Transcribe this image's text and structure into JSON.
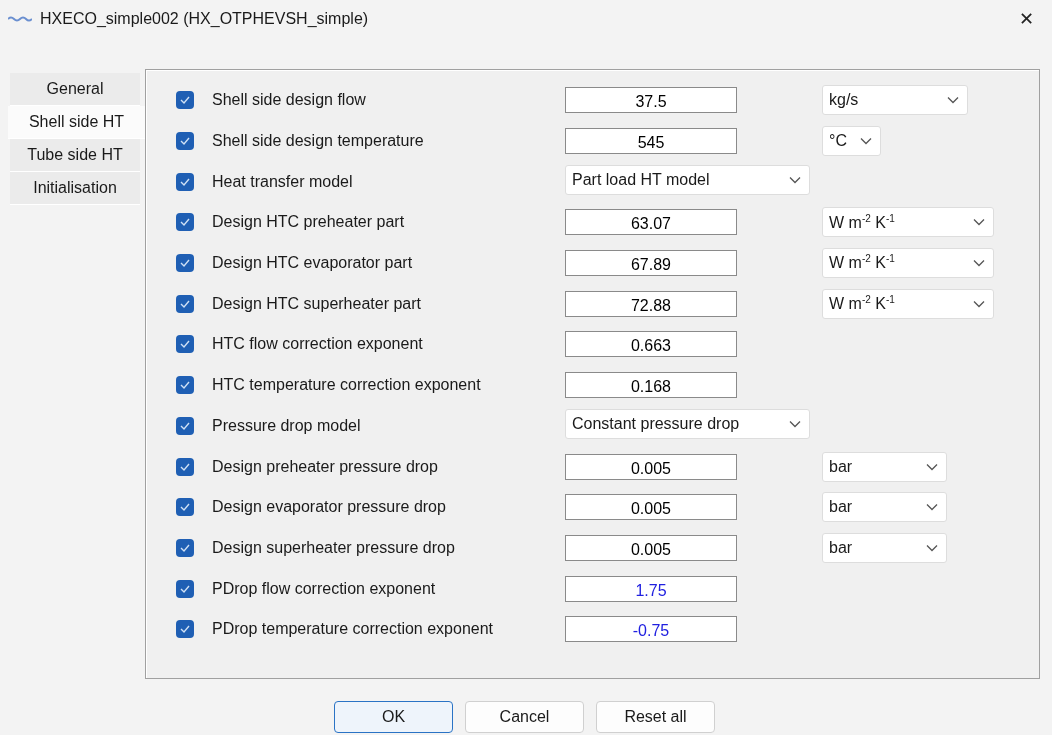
{
  "window": {
    "title": "HXECO_simple002 (HX_OTPHEVSH_simple)",
    "close": "✕"
  },
  "tabs": [
    {
      "label": "General",
      "selected": false
    },
    {
      "label": "Shell side HT",
      "selected": true
    },
    {
      "label": "Tube side HT",
      "selected": false
    },
    {
      "label": "Initialisation",
      "selected": false
    }
  ],
  "parameters": [
    {
      "kind": "field",
      "checked": true,
      "label": "Shell side design flow",
      "value": "37.5",
      "edited": false,
      "unit": "kg/s"
    },
    {
      "kind": "field",
      "checked": true,
      "label": "Shell side design temperature",
      "value": "545",
      "edited": false,
      "unit": "°C"
    },
    {
      "kind": "select",
      "checked": true,
      "label": "Heat transfer model",
      "value": "Part load HT model"
    },
    {
      "kind": "field",
      "checked": true,
      "label": "Design HTC preheater part",
      "value": "63.07",
      "edited": false,
      "unit": "W m$^{-2}$ K$^{-1}$"
    },
    {
      "kind": "field",
      "checked": true,
      "label": "Design HTC evaporator part",
      "value": "67.89",
      "edited": false,
      "unit": "W m$^{-2}$ K$^{-1}$"
    },
    {
      "kind": "field",
      "checked": true,
      "label": "Design HTC superheater part",
      "value": "72.88",
      "edited": false,
      "unit": "W m$^{-2}$ K$^{-1}$"
    },
    {
      "kind": "field",
      "checked": true,
      "label": "HTC flow correction exponent",
      "value": "0.663",
      "edited": false
    },
    {
      "kind": "field",
      "checked": true,
      "label": "HTC temperature correction exponent",
      "value": "0.168",
      "edited": false
    },
    {
      "kind": "select",
      "checked": true,
      "label": "Pressure drop model",
      "value": "Constant pressure drop"
    },
    {
      "kind": "field",
      "checked": true,
      "label": "Design preheater pressure drop",
      "value": "0.005",
      "edited": false,
      "unit": "bar"
    },
    {
      "kind": "field",
      "checked": true,
      "label": "Design evaporator pressure drop",
      "value": "0.005",
      "edited": false,
      "unit": "bar"
    },
    {
      "kind": "field",
      "checked": true,
      "label": "Design superheater pressure drop",
      "value": "0.005",
      "edited": false,
      "unit": "bar"
    },
    {
      "kind": "field",
      "checked": true,
      "label": "PDrop flow correction exponent",
      "value": "1.75",
      "edited": true
    },
    {
      "kind": "field",
      "checked": true,
      "label": "PDrop temperature correction exponent",
      "value": "-0.75",
      "edited": true
    }
  ],
  "buttons": [
    {
      "label": "OK",
      "default": true
    },
    {
      "label": "Cancel",
      "default": false
    },
    {
      "label": "Reset all",
      "default": false
    }
  ]
}
